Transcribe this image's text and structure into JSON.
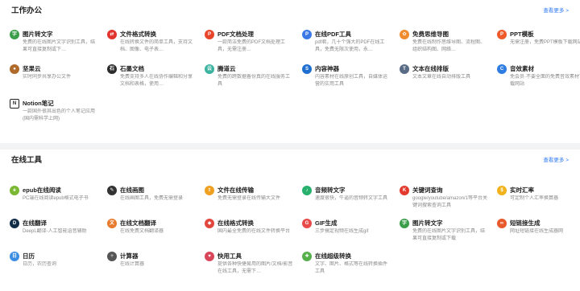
{
  "office": {
    "title": "工作办公",
    "more": "查看更多 >",
    "items": [
      {
        "name": "图片转文字",
        "desc": "免费的在线图片文字识别工具，结果可直接复制或下…",
        "icon": "image-text-icon",
        "color": "#3a9d4a",
        "glyph": "字"
      },
      {
        "name": "文件格式转换",
        "desc": "在线转换文件的简单工具，支持文档、图像、电子表…",
        "icon": "convert-icon",
        "color": "#e0342c",
        "glyph": "⇄"
      },
      {
        "name": "PDF文档处理",
        "desc": "一款简洁免费的PDF文档处理工具，无需注册…",
        "icon": "pdf-icon",
        "color": "#e8452b",
        "glyph": "P"
      },
      {
        "name": "在线PDF工具",
        "desc": "pdf君，几十个强大的PDF在线工具，免费无限次使用，永…",
        "icon": "pdf-tools-icon",
        "color": "#3c79e6",
        "glyph": "P"
      },
      {
        "name": "免费思维导图",
        "desc": "免费在线制作思维导图、流程图、组织结构图、网络…",
        "icon": "mindmap-icon",
        "color": "#f08c2e",
        "glyph": "✿"
      },
      {
        "name": "PPT模板",
        "desc": "无需注册，免费PPT模板下载网站",
        "icon": "ppt-icon",
        "color": "#ee5a2a",
        "glyph": "P"
      },
      {
        "name": "坚果云",
        "desc": "实时同步共享办公文件",
        "icon": "nutstore-icon",
        "color": "#b06a2a",
        "glyph": "●"
      },
      {
        "name": "石墨文档",
        "desc": "免费支持多人在线协作编辑和分享文档和表格，使用…",
        "icon": "shimo-icon",
        "color": "#2b2b2b",
        "glyph": "石"
      },
      {
        "name": "腾道云",
        "desc": "免费的跨数据备份真的在线服务工具",
        "icon": "cloud-icon",
        "color": "#3bb3a0",
        "glyph": "云"
      },
      {
        "name": "内容神器",
        "desc": "内容素材在线原创工具，自媒体运营的实用工具",
        "icon": "content-icon",
        "color": "#1f6fd1",
        "glyph": "S"
      },
      {
        "name": "文本在线排版",
        "desc": "文本文章在线自动排版工具",
        "icon": "text-layout-icon",
        "color": "#5a6b86",
        "glyph": "T"
      },
      {
        "name": "音效素材",
        "desc": "免会员·不要全面的免费音效素材下载网站",
        "icon": "sound-icon",
        "color": "#2f7de1",
        "glyph": "C"
      },
      {
        "name": "Notion笔记",
        "desc": "一款国外很其出色的个人笔记应用(国内需科学上网)",
        "icon": "notion-icon",
        "color": "#ffffff",
        "glyph": "N"
      }
    ]
  },
  "tools": {
    "title": "在线工具",
    "more": "查看更多 >",
    "items": [
      {
        "name": "epub在线阅读",
        "desc": "PC端在线阅读epub格式电子书",
        "icon": "epub-icon",
        "color": "#79b830",
        "glyph": "e"
      },
      {
        "name": "在线画图",
        "desc": "在线画图工具，免费无需登录",
        "icon": "draw-icon",
        "color": "#333333",
        "glyph": "✎"
      },
      {
        "name": "文件在线传输",
        "desc": "免费无需登录在线传输大文件",
        "icon": "transfer-icon",
        "color": "#f0a020",
        "glyph": "⇪"
      },
      {
        "name": "音频转文字",
        "desc": "速度很快，牛逼的音频转文字工具",
        "icon": "audio-icon",
        "color": "#27b06e",
        "glyph": "♪"
      },
      {
        "name": "关键词查询",
        "desc": "google/youtube/amazon/1等平台关键词搜索查询工具",
        "icon": "keyword-icon",
        "color": "#e23b2e",
        "glyph": "K"
      },
      {
        "name": "实时汇率",
        "desc": "可定制个人汇率换算器",
        "icon": "exchange-icon",
        "color": "#f2b21c",
        "glyph": "$"
      },
      {
        "name": "在线翻译",
        "desc": "DeepL翻译-人工智能语音辅助",
        "icon": "translate-icon",
        "color": "#0f2b46",
        "glyph": "D"
      },
      {
        "name": "在线文档翻译",
        "desc": "在线免费文档翻译器",
        "icon": "doc-translate-icon",
        "color": "#e77a2c",
        "glyph": "文"
      },
      {
        "name": "在线格式转换",
        "desc": "国内最全免费的在线文件转换平台",
        "icon": "format-icon",
        "color": "#e2473d",
        "glyph": "◆"
      },
      {
        "name": "GIF生成",
        "desc": "三步搞定视频在线生成gif",
        "icon": "gif-icon",
        "color": "#e84a4a",
        "glyph": "G"
      },
      {
        "name": "图片转文字",
        "desc": "免费的在线图片文字识别工具，结果可直接复制或下载",
        "icon": "ocr-icon",
        "color": "#3a9d4a",
        "glyph": "字"
      },
      {
        "name": "短链接生成",
        "desc": "网址短链接在线生成器网",
        "icon": "link-icon",
        "color": "#e85a2c",
        "glyph": "∞"
      },
      {
        "name": "日历",
        "desc": "日历，农历查询",
        "icon": "calendar-icon",
        "color": "#3a8de0",
        "glyph": "日"
      },
      {
        "name": "计算器",
        "desc": "在线计算器",
        "icon": "calculator-icon",
        "color": "#555555",
        "glyph": "÷"
      },
      {
        "name": "快用工具",
        "desc": "提供各种快捷易用的图片/文档/影音在线工具，无需下…",
        "icon": "tools-icon",
        "color": "#d9465a",
        "glyph": "♥"
      },
      {
        "name": "在线超级转换",
        "desc": "文字、图片、格式等在线转换插件工具",
        "icon": "super-convert-icon",
        "color": "#56b04a",
        "glyph": "✚"
      }
    ]
  }
}
